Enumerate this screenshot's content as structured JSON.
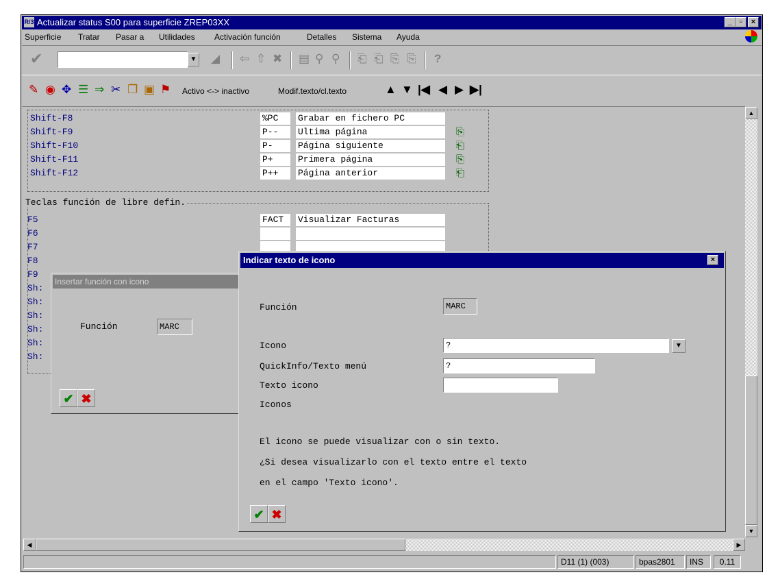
{
  "window": {
    "title": "Actualizar status S00 para superficie ZREP03XX",
    "app_icon": "R/3"
  },
  "menu": [
    "Superficie",
    "Tratar",
    "Pasar a",
    "Utilidades",
    "Activación función",
    "Detalles",
    "Sistema",
    "Ayuda"
  ],
  "toolbar2": {
    "activo_label": "Activo <-> inactivo",
    "modif_label": "Modif.texto/cl.texto"
  },
  "shift_rows": [
    {
      "key": "Shift-F8",
      "code": "%PC",
      "text": "Grabar en fichero PC"
    },
    {
      "key": "Shift-F9",
      "code": "P--",
      "text": "Ultima página"
    },
    {
      "key": "Shift-F10",
      "code": "P-",
      "text": "Página siguiente"
    },
    {
      "key": "Shift-F11",
      "code": "P+",
      "text": "Primera página"
    },
    {
      "key": "Shift-F12",
      "code": "P++",
      "text": "Página anterior"
    }
  ],
  "free_section": {
    "heading": "Teclas función de libre defin.",
    "rows": [
      {
        "key": "F5",
        "code": "FACT",
        "text": "Visualizar Facturas"
      },
      {
        "key": "F6",
        "code": "",
        "text": ""
      },
      {
        "key": "F7",
        "code": "",
        "text": ""
      },
      {
        "key": "F8",
        "code": "",
        "text": ""
      },
      {
        "key": "F9",
        "code": "",
        "text": ""
      },
      {
        "key": "Sh:",
        "code": "",
        "text": ""
      },
      {
        "key": "Sh:",
        "code": "",
        "text": ""
      },
      {
        "key": "Sh:",
        "code": "",
        "text": ""
      },
      {
        "key": "Sh:",
        "code": "",
        "text": ""
      },
      {
        "key": "Sh:",
        "code": "",
        "text": ""
      },
      {
        "key": "Sh:",
        "code": "",
        "text": ""
      }
    ]
  },
  "dialog_insert": {
    "title": "Insertar función con icono",
    "funcion_label": "Función",
    "funcion_value": "MARC"
  },
  "dialog_icon": {
    "title": "Indicar texto de icono",
    "funcion_label": "Función",
    "funcion_value": "MARC",
    "icono_label": "Icono",
    "icono_value": "?",
    "quickinfo_label": "QuickInfo/Texto menú",
    "quickinfo_value": "?",
    "texto_icono_label": "Texto icono",
    "texto_icono_value": "",
    "iconos_label": "Iconos",
    "info_lines": [
      "El icono se puede visualizar con o sin texto.",
      "¿Si desea visualizarlo con el texto entre el texto",
      "en el campo 'Texto icono'."
    ]
  },
  "status": {
    "system": "D11 (1) (003)",
    "server": "bpas2801",
    "mode": "INS",
    "time": "0.11"
  },
  "colors": {
    "title_active": "#000080",
    "title_inactive": "#808080",
    "window_bg": "#c0c0c0",
    "key_text": "#000080",
    "ok_green": "#008000",
    "cancel_red": "#cc0000"
  }
}
